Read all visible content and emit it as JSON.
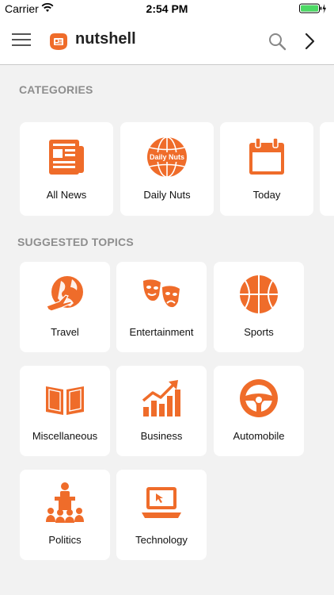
{
  "status_bar": {
    "carrier": "Carrier",
    "time": "2:54 PM"
  },
  "header": {
    "brand_name": "nutshell",
    "menu_icon": "hamburger-icon",
    "search_icon": "search-icon",
    "next_icon": "chevron-right-icon"
  },
  "colors": {
    "accent": "#ef6c2a",
    "background": "#f2f2f2",
    "card": "#ffffff",
    "section_title": "#8e8e8e"
  },
  "categories": {
    "title": "CATEGORIES",
    "items": [
      {
        "label": "All News",
        "icon": "newspaper-icon"
      },
      {
        "label": "Daily Nuts",
        "icon": "daily-nuts-globe-icon",
        "icon_text": "Daily Nuts"
      },
      {
        "label": "Today",
        "icon": "calendar-icon"
      }
    ]
  },
  "topics": {
    "title": "SUGGESTED TOPICS",
    "items": [
      {
        "label": "Travel",
        "icon": "globe-airplane-icon"
      },
      {
        "label": "Entertainment",
        "icon": "theater-masks-icon"
      },
      {
        "label": "Sports",
        "icon": "basketball-icon"
      },
      {
        "label": "Miscellaneous",
        "icon": "open-book-icon"
      },
      {
        "label": "Business",
        "icon": "growth-chart-icon"
      },
      {
        "label": "Automobile",
        "icon": "steering-wheel-icon"
      },
      {
        "label": "Politics",
        "icon": "podium-speaker-icon"
      },
      {
        "label": "Technology",
        "icon": "laptop-icon"
      }
    ]
  }
}
